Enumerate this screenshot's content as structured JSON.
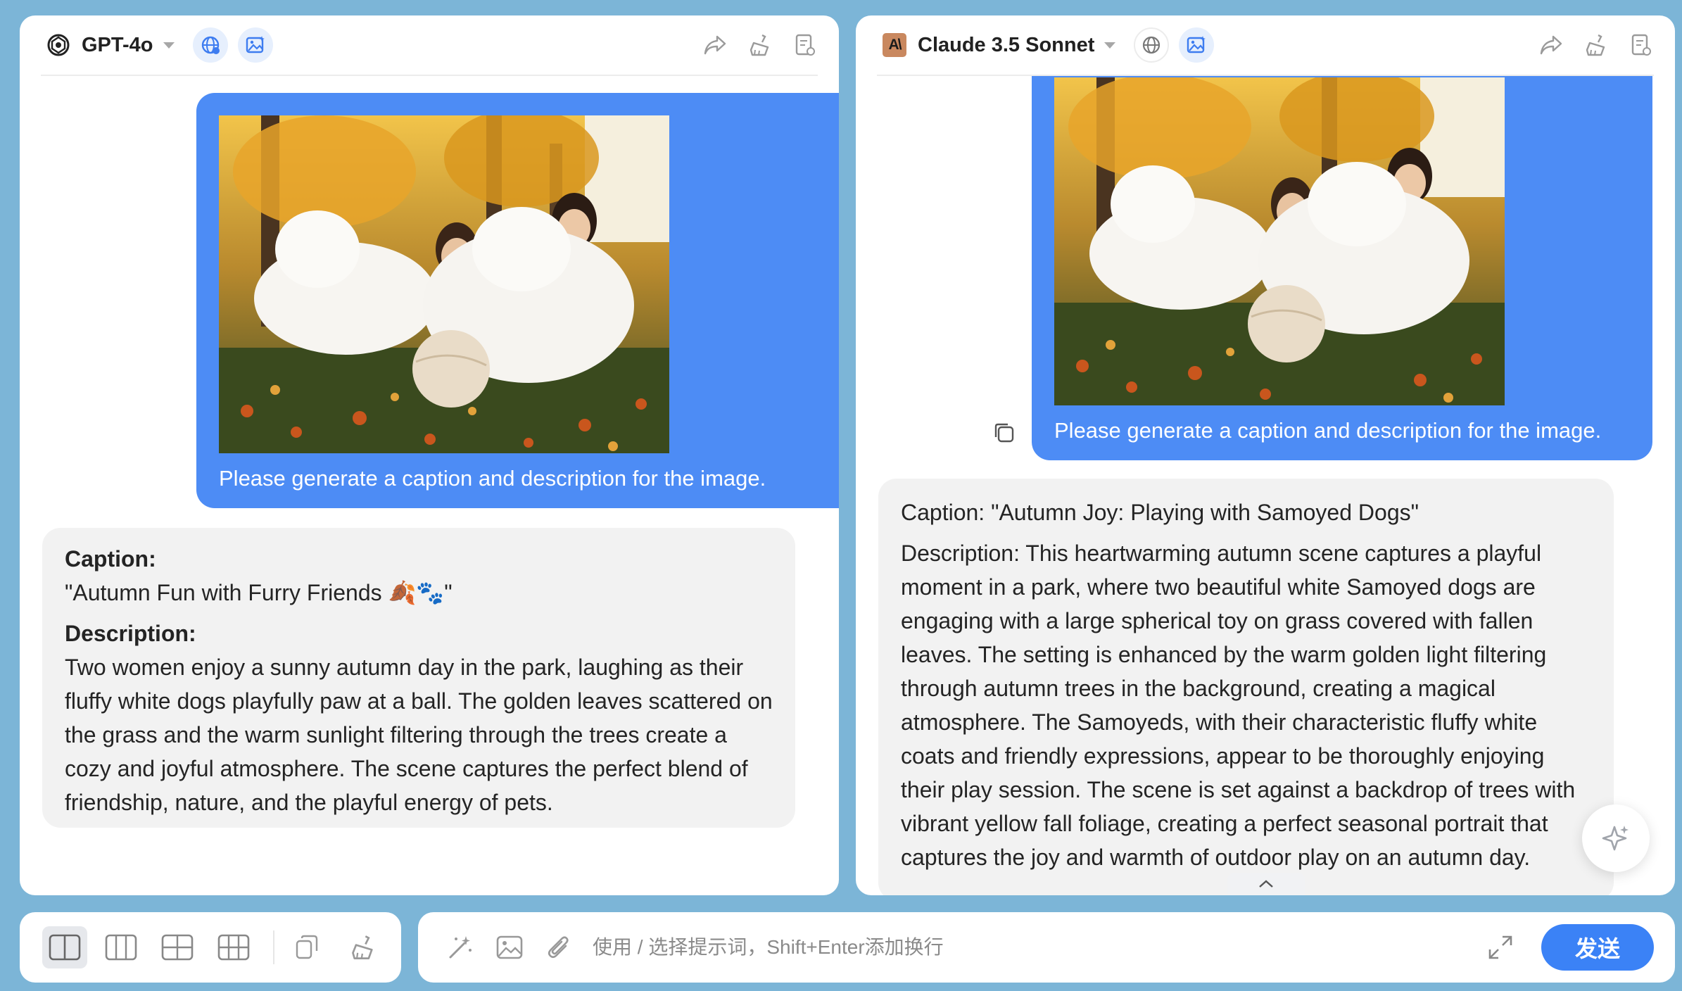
{
  "panels": [
    {
      "model": "GPT-4o",
      "logo": "openai-logo",
      "web_search": "on",
      "image_gen": "on",
      "user_message": "Please generate a caption and description for the image.",
      "response": {
        "caption_label": "Caption:",
        "caption": "\"Autumn Fun with Furry Friends 🍂🐾\"",
        "description_label": "Description:",
        "description": "Two women enjoy a sunny autumn day in the park, laughing as their fluffy white dogs playfully paw at a ball. The golden leaves scattered on the grass and the warm sunlight filtering through the trees create a cozy and joyful atmosphere. The scene captures the perfect blend of friendship, nature, and the playful energy of pets."
      }
    },
    {
      "model": "Claude 3.5 Sonnet",
      "logo": "anthropic-logo",
      "logo_text": "A\\",
      "web_search": "off",
      "image_gen": "on",
      "user_message": "Please generate a caption and description for the image.",
      "response": {
        "caption": "Caption: \"Autumn Joy: Playing with Samoyed Dogs\"",
        "description": "Description: This heartwarming autumn scene captures a playful moment in a park, where two beautiful white Samoyed dogs are engaging with a large spherical toy on grass covered with fallen leaves. The setting is enhanced by the warm golden light filtering through autumn trees in the background, creating a magical atmosphere. The Samoyeds, with their characteristic fluffy white coats and friendly expressions, appear to be thoroughly enjoying their play session. The scene is set against a backdrop of trees with vibrant yellow fall foliage, creating a perfect seasonal portrait that captures the joy and warmth of outdoor play on an autumn day."
      }
    }
  ],
  "header_icons": [
    "share-icon",
    "clear-icon",
    "document-icon"
  ],
  "layout_buttons": [
    "single-pane",
    "two-columns",
    "four-grid",
    "six-grid"
  ],
  "bottom_actions": [
    "copy-icon",
    "clear-all-icon"
  ],
  "input": {
    "placeholder": "使用 / 选择提示词，Shift+Enter添加换行",
    "value": ""
  },
  "input_icons": [
    "magic-wand-icon",
    "image-upload-icon",
    "attachment-icon"
  ],
  "send_label": "发送",
  "colors": {
    "background": "#7cb5d7",
    "user_bubble": "#4d8cf5",
    "ai_bubble": "#f2f2f2",
    "send_button": "#3b82f6"
  }
}
